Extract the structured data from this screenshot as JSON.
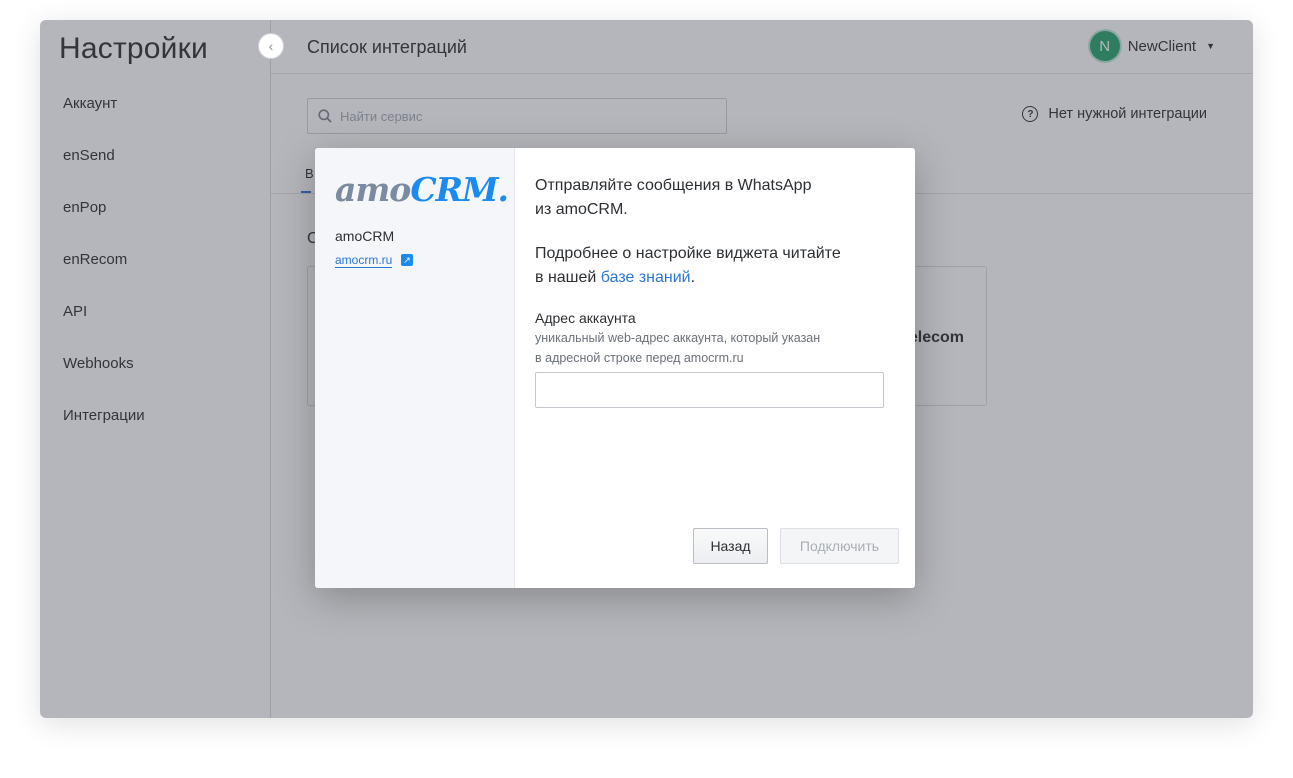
{
  "sidebar": {
    "title": "Настройки",
    "items": [
      {
        "label": "Аккаунт"
      },
      {
        "label": "enSend"
      },
      {
        "label": "enPop"
      },
      {
        "label": "enRecom"
      },
      {
        "label": "API"
      },
      {
        "label": "Webhooks"
      },
      {
        "label": "Интеграции"
      }
    ]
  },
  "header": {
    "title": "Список интеграций",
    "user": {
      "initial": "N",
      "name": "NewClient",
      "avatar_color": "#27a36e"
    }
  },
  "main": {
    "search_placeholder": "Найти сервис",
    "no_integration_label": "Нет нужной интеграции",
    "tab_fragment": "В",
    "section_fragment": "С",
    "card_fragment": "elecom"
  },
  "modal": {
    "logo": {
      "amo": "amo",
      "crm": "CRM."
    },
    "service_name": "amoCRM",
    "service_link": "amocrm.ru",
    "description": "Отправляйте сообщения в WhatsApp\nиз amoCRM.",
    "more_info_prefix": "Подробнее о настройке виджета читайте\nв нашей ",
    "more_info_link": "базе знаний",
    "more_info_suffix": ".",
    "field_label": "Адрес аккаунта",
    "field_hint": "уникальный web-адрес аккаунта, который указан\nв адресной строке перед amocrm.ru",
    "field_value": "",
    "back_button": "Назад",
    "connect_button": "Подключить"
  },
  "colors": {
    "accent": "#2c77d6",
    "logo_blue": "#1b8bf0",
    "logo_gray": "#7a8aa0"
  }
}
